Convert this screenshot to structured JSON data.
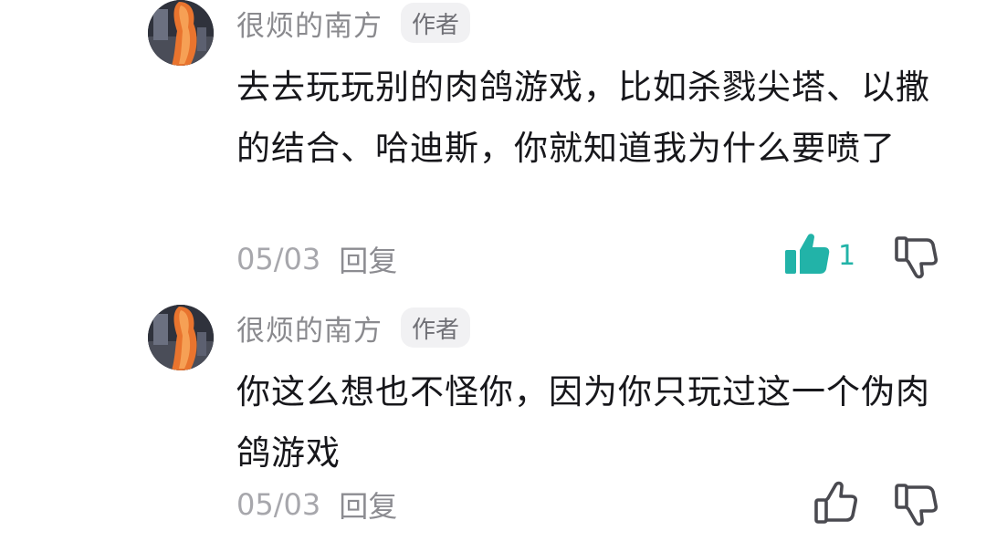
{
  "colors": {
    "accent_teal": "#22b3a8",
    "text_primary": "#17171b",
    "text_muted": "#8a8a8e"
  },
  "comments": [
    {
      "username": "很烦的南方",
      "badge": "作者",
      "avatar_icon": "user-avatar",
      "content": "去去玩玩别的肉鸽游戏，比如杀戮尖塔、以撒的结合、哈迪斯，你就知道我为什么要喷了",
      "date": "05/03",
      "reply_label": "回复",
      "likes": "1",
      "liked": true,
      "like_icon": "thumbs-up-filled-icon",
      "dislike_icon": "thumbs-down-icon"
    },
    {
      "username": "很烦的南方",
      "badge": "作者",
      "avatar_icon": "user-avatar",
      "content": "你这么想也不怪你，因为你只玩过这一个伪肉鸽游戏",
      "date": "05/03",
      "reply_label": "回复",
      "liked": false,
      "like_icon": "thumbs-up-icon",
      "dislike_icon": "thumbs-down-icon"
    }
  ]
}
